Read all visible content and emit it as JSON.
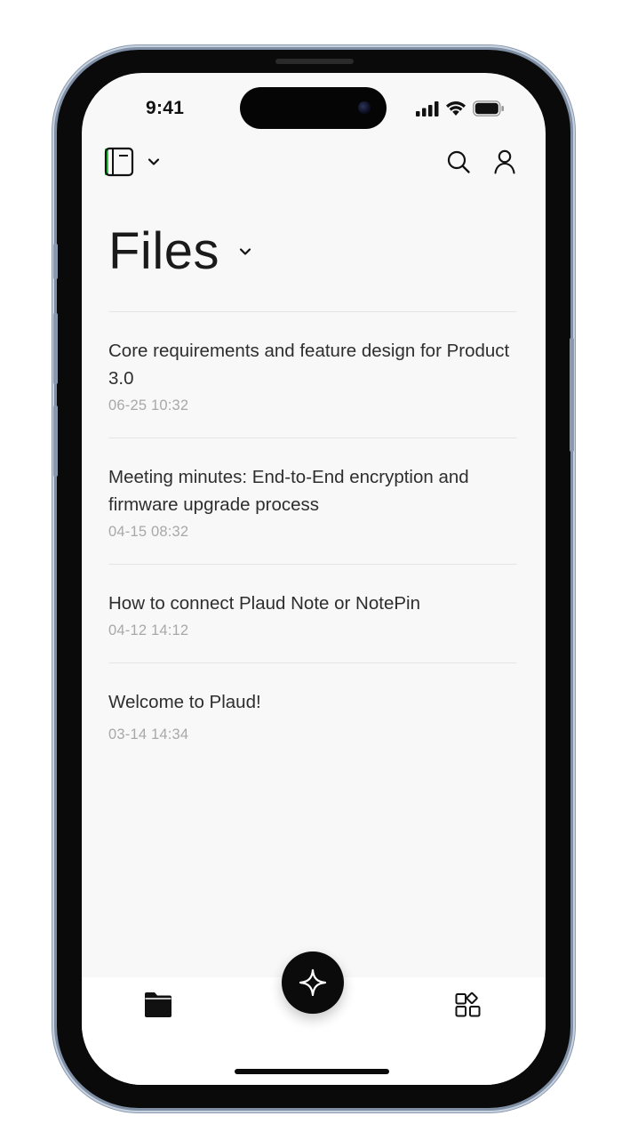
{
  "status_bar": {
    "time": "9:41",
    "icons": [
      "signal-icon",
      "wifi-icon",
      "battery-icon"
    ]
  },
  "header": {
    "left_icons": [
      "device-icon",
      "chevron-down-icon"
    ],
    "right_icons": [
      "search-icon",
      "profile-icon"
    ],
    "accent_color": "#2ecc40"
  },
  "page": {
    "title": "Files"
  },
  "files": [
    {
      "title": "Core requirements and feature design for Product 3.0",
      "date": "06-25 10:32"
    },
    {
      "title": "Meeting minutes: End-to-End encryption and firmware upgrade process",
      "date": "04-15 08:32"
    },
    {
      "title": "How to connect Plaud Note or NotePin",
      "date": "04-12 14:12"
    },
    {
      "title": "Welcome to Plaud!",
      "date": "03-14 14:34"
    }
  ],
  "bottom_nav": {
    "icons": [
      "folder-icon",
      "add-sparkle-icon",
      "apps-icon"
    ]
  }
}
